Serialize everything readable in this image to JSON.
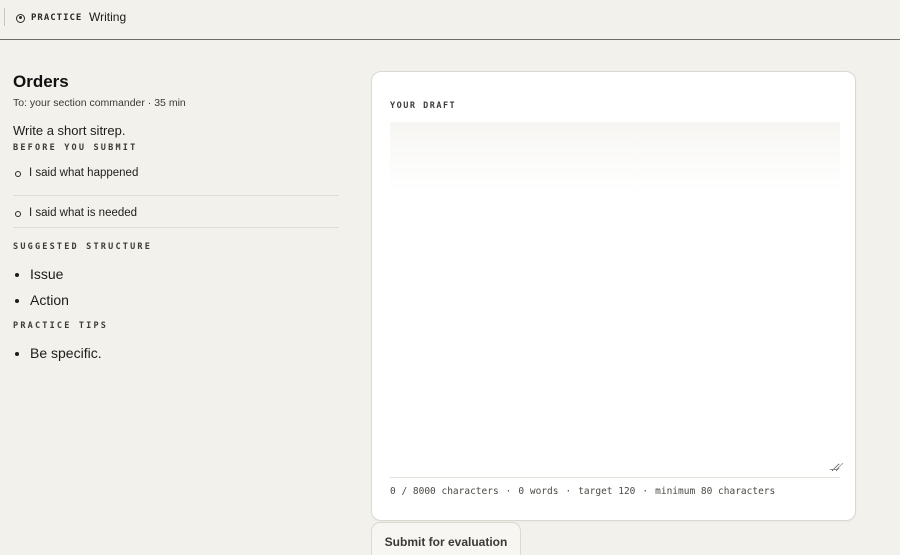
{
  "topbar": {
    "brand": "PRACTICE",
    "nav_item": "Writing"
  },
  "orders": {
    "title": "Orders",
    "meta": "To: your section commander · 35 min",
    "task": "Write a short sitrep."
  },
  "before_submit": {
    "label": "BEFORE YOU SUBMIT",
    "items": [
      "I said what happened",
      "I said what is needed"
    ]
  },
  "structure": {
    "label": "SUGGESTED STRUCTURE",
    "items": [
      "Issue",
      "Action"
    ]
  },
  "tips": {
    "label": "PRACTICE TIPS",
    "items": [
      "Be specific."
    ]
  },
  "draft": {
    "label": "YOUR DRAFT",
    "value": "",
    "counter": {
      "characters": "0 / 8000 characters",
      "sep": "·",
      "words": "0 words",
      "target": "target 120",
      "minimum": "minimum 80 characters"
    }
  },
  "submit_label": "Submit for evaluation",
  "colors": {
    "background": "#f3f1ec",
    "card": "#ffffff",
    "text": "#1c1c1a"
  }
}
